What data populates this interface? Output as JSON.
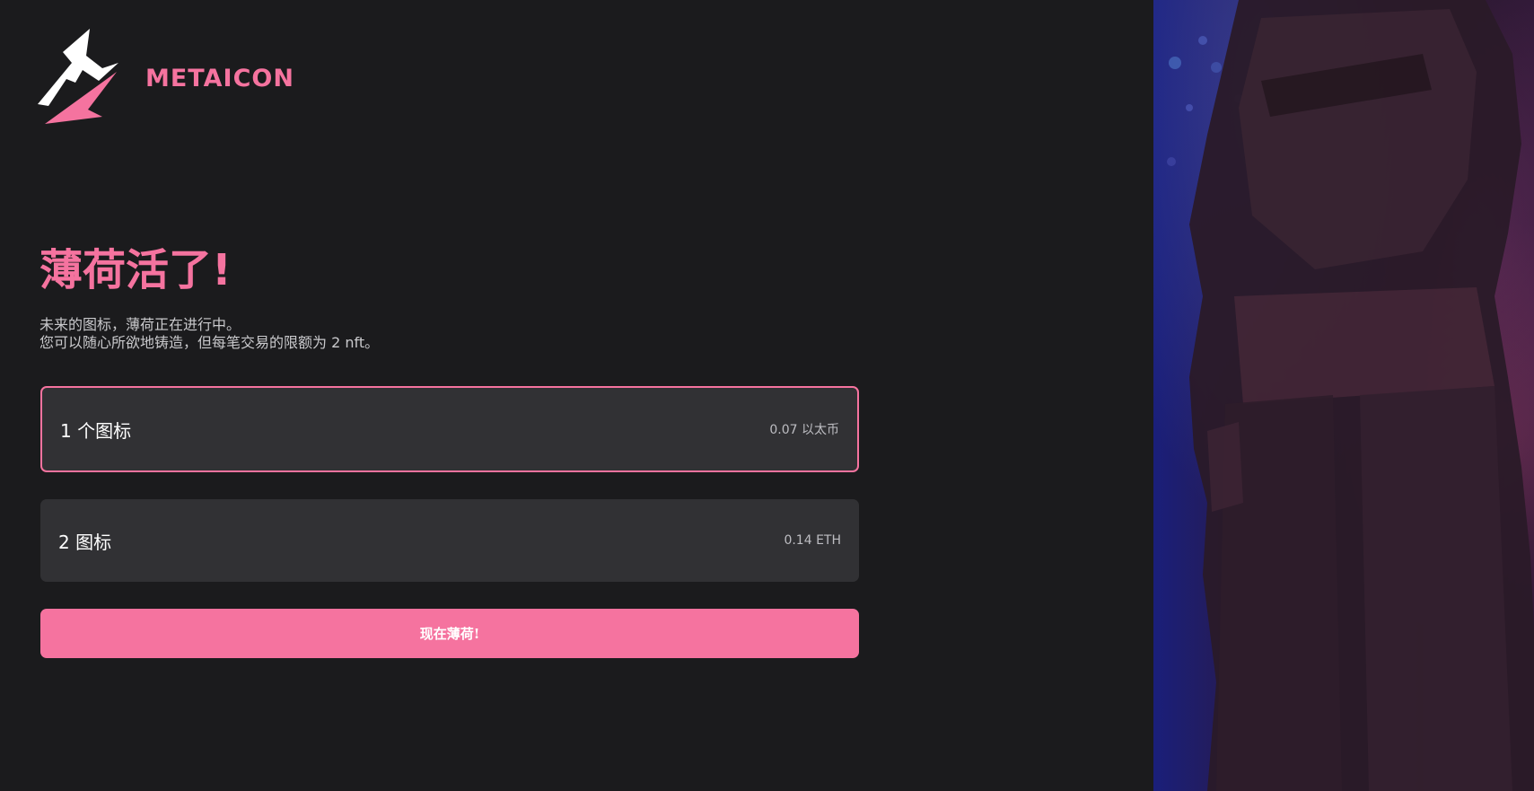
{
  "brand": {
    "name": "METAICON",
    "logo_icon": "lightning-claw-logo"
  },
  "hero": {
    "title": "薄荷活了!",
    "description_lines": [
      "未来的图标，薄荷正在进行中。",
      "您可以随心所欲地铸造，但每笔交易的限额为 2 nft。"
    ]
  },
  "options": [
    {
      "label": "1 个图标",
      "price": "0.07 以太币",
      "selected": true
    },
    {
      "label": "2 图标",
      "price": "0.14 ETH",
      "selected": false
    }
  ],
  "mint_button": {
    "label": "现在薄荷!"
  },
  "colors": {
    "background": "#1b1b1d",
    "accent": "#f5739f",
    "card": "#313134",
    "text_muted": "#c9c9cc"
  }
}
